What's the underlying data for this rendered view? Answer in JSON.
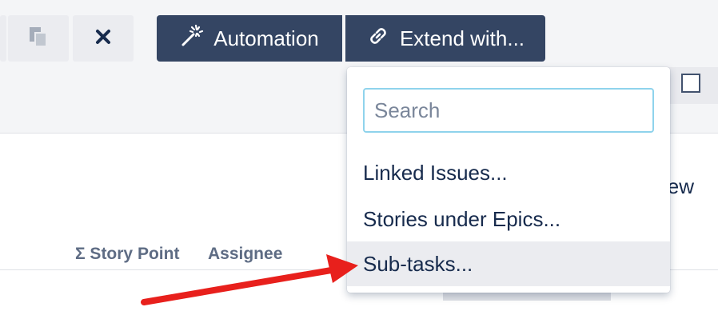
{
  "toolbar": {
    "automation_label": "Automation",
    "extend_label": "Extend with..."
  },
  "dropdown": {
    "search_placeholder": "Search",
    "items": [
      {
        "label": "Linked Issues..."
      },
      {
        "label": "Stories under Epics..."
      },
      {
        "label": "Sub-tasks..."
      }
    ],
    "highlighted_index": 2
  },
  "background": {
    "view_text_fragment": "view",
    "columns": [
      "Σ Story Point",
      "Assignee"
    ]
  },
  "colors": {
    "dark_button": "#344563",
    "toolbar_bg": "#f4f5f7",
    "highlight": "#ebecf0",
    "search_focus": "#8fd3ec",
    "annotation_arrow": "#e8201c"
  },
  "icons": {
    "copy": "copy-icon",
    "close": "close-icon",
    "automation": "magic-wand-icon",
    "extend": "link-icon",
    "checkbox": "checkbox-icon"
  }
}
